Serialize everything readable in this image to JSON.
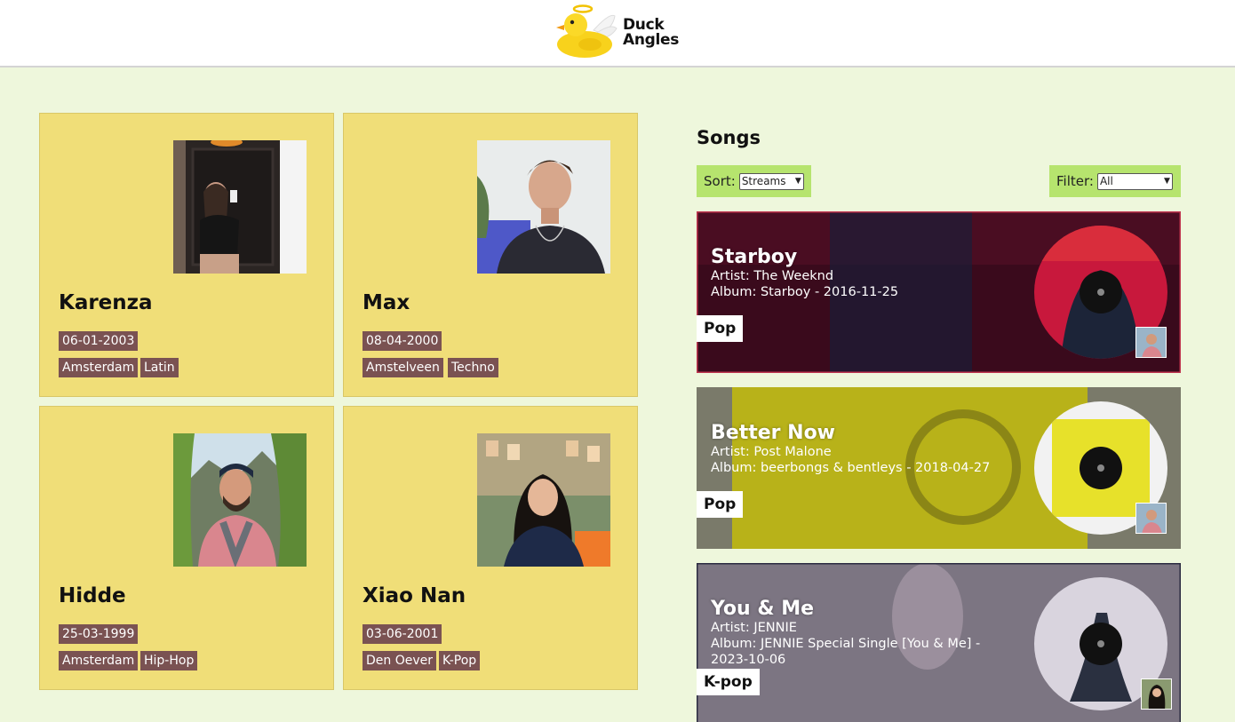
{
  "brand": {
    "line1": "Duck",
    "line2": "Angles",
    "logo_icon": "duck-angel-logo"
  },
  "members": [
    {
      "name": "Karenza",
      "birthdate": "06-01-2003",
      "city": "Amsterdam",
      "genre": "Latin"
    },
    {
      "name": "Max",
      "birthdate": "08-04-2000",
      "city": "Amstelveen",
      "genre": "Techno"
    },
    {
      "name": "Hidde",
      "birthdate": "25-03-1999",
      "city": "Amsterdam",
      "genre": "Hip-Hop"
    },
    {
      "name": "Xiao Nan",
      "birthdate": "03-06-2001",
      "city": "Den Oever",
      "genre": "K-Pop"
    }
  ],
  "songs_section": {
    "title": "Songs",
    "sort_label": "Sort:",
    "sort_value": "Streams",
    "filter_label": "Filter:",
    "filter_value": "All"
  },
  "songs": [
    {
      "title": "Starboy",
      "artist": "Artist: The Weeknd",
      "album": "Album: Starboy - 2016-11-25",
      "album_extra": "",
      "genre": "Pop"
    },
    {
      "title": "Better Now",
      "artist": "Artist: Post Malone",
      "album": "Album: beerbongs & bentleys - 2018-04-27",
      "album_extra": "",
      "genre": "Pop"
    },
    {
      "title": "You & Me",
      "artist": "Artist: JENNIE",
      "album": "Album: JENNIE Special Single [You & Me] -",
      "album_extra": "2023-10-06",
      "genre": "K-pop"
    }
  ],
  "colors": {
    "background": "#eef7dc",
    "card": "#f0de78",
    "tag": "#7a5252",
    "control": "#b6e46e"
  }
}
